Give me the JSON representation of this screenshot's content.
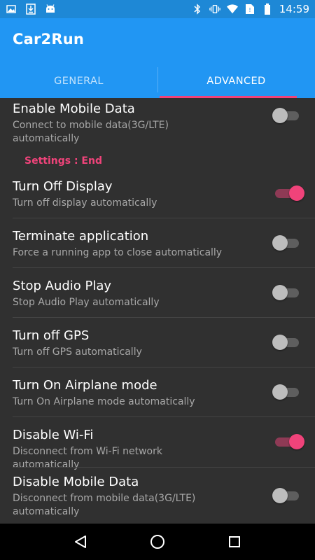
{
  "status_bar": {
    "time": "14:59",
    "left_icons": [
      "image-icon",
      "download-icon",
      "android-icon"
    ],
    "right_icons": [
      "bluetooth-icon",
      "vibrate-icon",
      "wifi-icon",
      "no-sim-icon",
      "battery-icon"
    ]
  },
  "app": {
    "title": "Car2Run",
    "accent": "#f0437a",
    "primary": "#2196f3"
  },
  "tabs": [
    {
      "label": "GENERAL",
      "active": false
    },
    {
      "label": "ADVANCED",
      "active": true
    }
  ],
  "settings_top": {
    "title": "Enable Mobile Data",
    "summary": "Connect to mobile data(3G/LTE) automatically",
    "enabled": false
  },
  "category": {
    "label": "Settings : End"
  },
  "settings": [
    {
      "title": "Turn Off Display",
      "summary": "Turn off display automatically",
      "enabled": true
    },
    {
      "title": "Terminate application",
      "summary": "Force a running app to close automatically",
      "enabled": false
    },
    {
      "title": "Stop Audio Play",
      "summary": "Stop Audio Play automatically",
      "enabled": false
    },
    {
      "title": "Turn off GPS",
      "summary": "Turn off GPS automatically",
      "enabled": false
    },
    {
      "title": "Turn On Airplane mode",
      "summary": "Turn On Airplane mode automatically",
      "enabled": false
    },
    {
      "title": "Disable Wi-Fi",
      "summary": "Disconnect from Wi-Fi network automatically",
      "enabled": true
    },
    {
      "title": "Disable Mobile Data",
      "summary": "Disconnect from mobile data(3G/LTE) automatically",
      "enabled": false
    }
  ],
  "nav_bar": {
    "buttons": [
      "back-icon",
      "home-icon",
      "recents-icon"
    ]
  }
}
